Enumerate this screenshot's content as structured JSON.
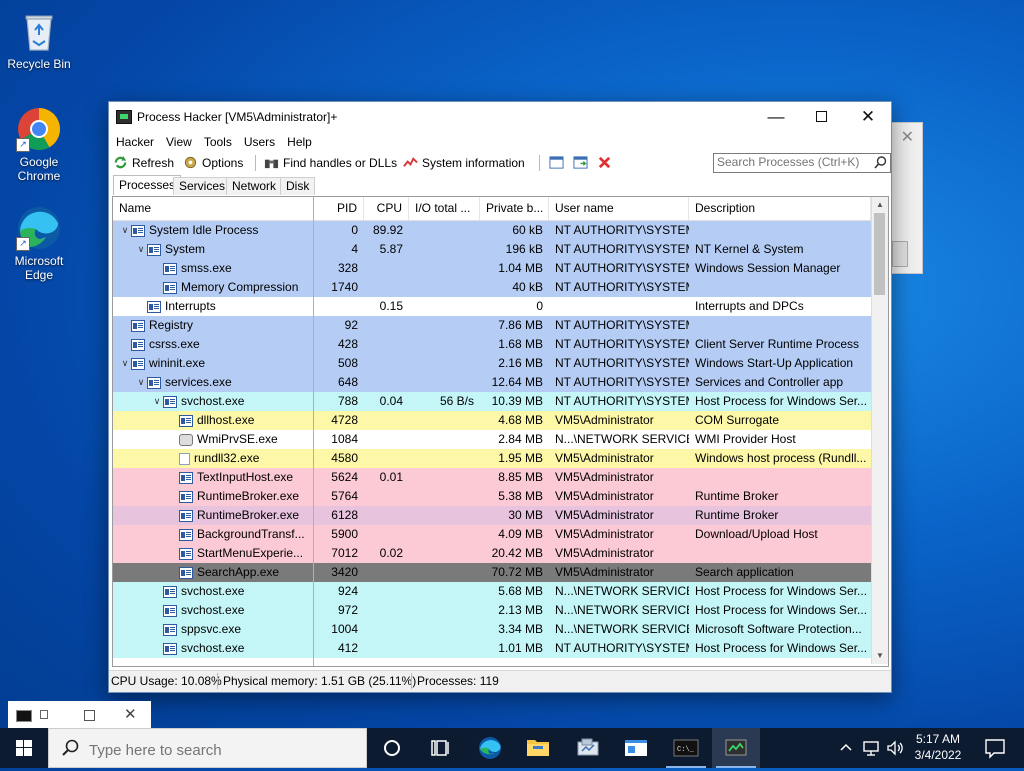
{
  "desktop": {
    "icons": [
      {
        "label": "Recycle Bin"
      },
      {
        "label": "Google\nChrome",
        "line1": "Google",
        "line2": "Chrome"
      },
      {
        "label": "Microsoft\nEdge",
        "line1": "Microsoft",
        "line2": "Edge"
      }
    ]
  },
  "window": {
    "title": "Process Hacker [VM5\\Administrator]+",
    "menu": [
      "Hacker",
      "View",
      "Tools",
      "Users",
      "Help"
    ],
    "toolbar": {
      "refresh": "Refresh",
      "options": "Options",
      "find_handles": "Find handles or DLLs",
      "system_info": "System information"
    },
    "search_placeholder": "Search Processes (Ctrl+K)",
    "tabs": [
      "Processes",
      "Services",
      "Network",
      "Disk"
    ],
    "columns": [
      "Name",
      "PID",
      "CPU",
      "I/O total ...",
      "Private b...",
      "User name",
      "Description"
    ],
    "rows": [
      {
        "indent": 0,
        "exp": "v",
        "name": "System Idle Process",
        "pid": "0",
        "cpu": "89.92",
        "io": "",
        "priv": "60 kB",
        "user": "NT AUTHORITY\\SYSTEM",
        "desc": "",
        "color": "#b5cdf5"
      },
      {
        "indent": 1,
        "exp": "v",
        "name": "System",
        "pid": "4",
        "cpu": "5.87",
        "io": "",
        "priv": "196 kB",
        "user": "NT AUTHORITY\\SYSTEM",
        "desc": "NT Kernel & System",
        "color": "#b5cdf5"
      },
      {
        "indent": 2,
        "exp": "",
        "name": "smss.exe",
        "pid": "328",
        "cpu": "",
        "io": "",
        "priv": "1.04 MB",
        "user": "NT AUTHORITY\\SYSTEM",
        "desc": "Windows Session Manager",
        "color": "#b5cdf5"
      },
      {
        "indent": 2,
        "exp": "",
        "name": "Memory Compression",
        "pid": "1740",
        "cpu": "",
        "io": "",
        "priv": "40 kB",
        "user": "NT AUTHORITY\\SYSTEM",
        "desc": "",
        "color": "#b5cdf5"
      },
      {
        "indent": 1,
        "exp": "",
        "name": "Interrupts",
        "pid": "",
        "cpu": "0.15",
        "io": "",
        "priv": "0",
        "user": "",
        "desc": "Interrupts and DPCs",
        "color": "#ffffff"
      },
      {
        "indent": 0,
        "exp": "",
        "name": "Registry",
        "pid": "92",
        "cpu": "",
        "io": "",
        "priv": "7.86 MB",
        "user": "NT AUTHORITY\\SYSTEM",
        "desc": "",
        "color": "#b5cdf5"
      },
      {
        "indent": 0,
        "exp": "",
        "name": "csrss.exe",
        "pid": "428",
        "cpu": "",
        "io": "",
        "priv": "1.68 MB",
        "user": "NT AUTHORITY\\SYSTEM",
        "desc": "Client Server Runtime Process",
        "color": "#b5cdf5"
      },
      {
        "indent": 0,
        "exp": "v",
        "name": "wininit.exe",
        "pid": "508",
        "cpu": "",
        "io": "",
        "priv": "2.16 MB",
        "user": "NT AUTHORITY\\SYSTEM",
        "desc": "Windows Start-Up Application",
        "color": "#b5cdf5"
      },
      {
        "indent": 1,
        "exp": "v",
        "name": "services.exe",
        "pid": "648",
        "cpu": "",
        "io": "",
        "priv": "12.64 MB",
        "user": "NT AUTHORITY\\SYSTEM",
        "desc": "Services and Controller app",
        "color": "#b5cdf5"
      },
      {
        "indent": 2,
        "exp": "v",
        "name": "svchost.exe",
        "pid": "788",
        "cpu": "0.04",
        "io": "56 B/s",
        "priv": "10.39 MB",
        "user": "NT AUTHORITY\\SYSTEM",
        "desc": "Host Process for Windows Ser...",
        "color": "#c4f6f8"
      },
      {
        "indent": 3,
        "exp": "",
        "name": "dllhost.exe",
        "pid": "4728",
        "cpu": "",
        "io": "",
        "priv": "4.68 MB",
        "user": "VM5\\Administrator",
        "desc": "COM Surrogate",
        "color": "#fdf7a8"
      },
      {
        "indent": 3,
        "exp": "",
        "name": "WmiPrvSE.exe",
        "pid": "1084",
        "cpu": "",
        "io": "",
        "priv": "2.84 MB",
        "user": "N...\\NETWORK SERVICE",
        "desc": "WMI Provider Host",
        "color": "#ffffff",
        "icon": "gear"
      },
      {
        "indent": 3,
        "exp": "",
        "name": "rundll32.exe",
        "pid": "4580",
        "cpu": "",
        "io": "",
        "priv": "1.95 MB",
        "user": "VM5\\Administrator",
        "desc": "Windows host process (Rundll...",
        "color": "#fdf7a8",
        "icon": "doc"
      },
      {
        "indent": 3,
        "exp": "",
        "name": "TextInputHost.exe",
        "pid": "5624",
        "cpu": "0.01",
        "io": "",
        "priv": "8.85 MB",
        "user": "VM5\\Administrator",
        "desc": "",
        "color": "#fccad5"
      },
      {
        "indent": 3,
        "exp": "",
        "name": "RuntimeBroker.exe",
        "pid": "5764",
        "cpu": "",
        "io": "",
        "priv": "5.38 MB",
        "user": "VM5\\Administrator",
        "desc": "Runtime Broker",
        "color": "#fccad5"
      },
      {
        "indent": 3,
        "exp": "",
        "name": "RuntimeBroker.exe",
        "pid": "6128",
        "cpu": "",
        "io": "",
        "priv": "30 MB",
        "user": "VM5\\Administrator",
        "desc": "Runtime Broker",
        "color": "#e8c3de"
      },
      {
        "indent": 3,
        "exp": "",
        "name": "BackgroundTransf...",
        "pid": "5900",
        "cpu": "",
        "io": "",
        "priv": "4.09 MB",
        "user": "VM5\\Administrator",
        "desc": "Download/Upload Host",
        "color": "#fccad5"
      },
      {
        "indent": 3,
        "exp": "",
        "name": "StartMenuExperie...",
        "pid": "7012",
        "cpu": "0.02",
        "io": "",
        "priv": "20.42 MB",
        "user": "VM5\\Administrator",
        "desc": "",
        "color": "#fccad5"
      },
      {
        "indent": 3,
        "exp": "",
        "name": "SearchApp.exe",
        "pid": "3420",
        "cpu": "",
        "io": "",
        "priv": "70.72 MB",
        "user": "VM5\\Administrator",
        "desc": "Search application",
        "color": "#7a7a7a"
      },
      {
        "indent": 2,
        "exp": "",
        "name": "svchost.exe",
        "pid": "924",
        "cpu": "",
        "io": "",
        "priv": "5.68 MB",
        "user": "N...\\NETWORK SERVICE",
        "desc": "Host Process for Windows Ser...",
        "color": "#c4f6f8"
      },
      {
        "indent": 2,
        "exp": "",
        "name": "svchost.exe",
        "pid": "972",
        "cpu": "",
        "io": "",
        "priv": "2.13 MB",
        "user": "N...\\NETWORK SERVICE",
        "desc": "Host Process for Windows Ser...",
        "color": "#c4f6f8"
      },
      {
        "indent": 2,
        "exp": "",
        "name": "sppsvc.exe",
        "pid": "1004",
        "cpu": "",
        "io": "",
        "priv": "3.34 MB",
        "user": "N...\\NETWORK SERVICE",
        "desc": "Microsoft Software Protection...",
        "color": "#c4f6f8"
      },
      {
        "indent": 2,
        "exp": "",
        "name": "svchost.exe",
        "pid": "412",
        "cpu": "",
        "io": "",
        "priv": "1.01 MB",
        "user": "NT AUTHORITY\\SYSTEM",
        "desc": "Host Process for Windows Ser...",
        "color": "#c4f6f8"
      }
    ],
    "status": {
      "cpu": "CPU Usage: 10.08%",
      "memory": "Physical memory: 1.51 GB (25.11%)",
      "processes": "Processes: 119"
    }
  },
  "taskbar": {
    "search_placeholder": "Type here to search",
    "time": "5:17 AM",
    "date": "3/4/2022"
  }
}
